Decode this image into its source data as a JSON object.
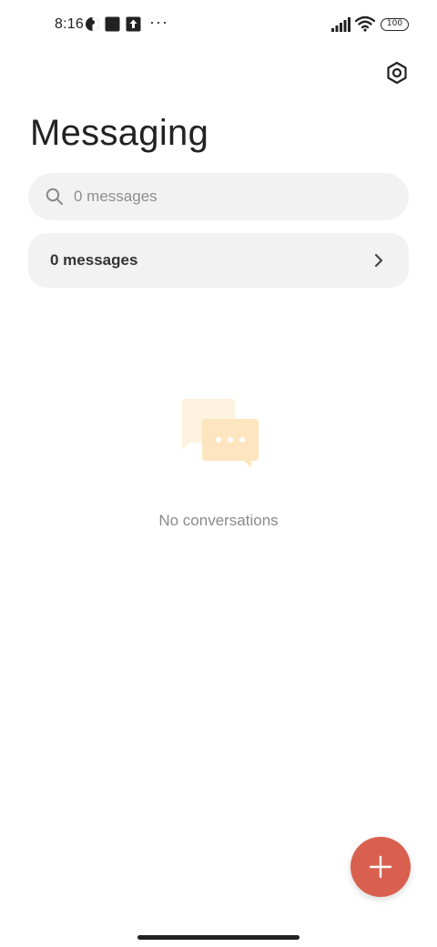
{
  "status_bar": {
    "time": "8:16",
    "more": "···",
    "battery": "100",
    "icons": [
      "vpn-circle-icon",
      "square-notification-icon",
      "upload-notification-icon",
      "signal-icon",
      "wifi-icon",
      "battery-icon"
    ]
  },
  "header": {
    "title": "Messaging",
    "settings_icon": "gear-hexagon-icon"
  },
  "search": {
    "placeholder": "0 messages",
    "value": ""
  },
  "messages_row": {
    "label": "0 messages"
  },
  "empty_state": {
    "text": "No conversations",
    "icon": "chat-bubbles-icon"
  },
  "fab": {
    "icon": "plus-icon"
  },
  "colors": {
    "accent": "#d9604f",
    "surface": "#f2f2f2",
    "illustration_back": "#fdf3e0",
    "illustration_front": "#fde6bf"
  }
}
